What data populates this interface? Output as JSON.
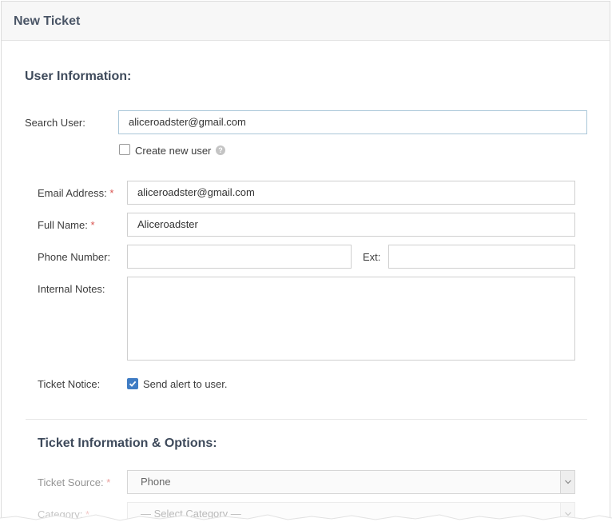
{
  "header": {
    "title": "New Ticket"
  },
  "user_info": {
    "section_title": "User Information:",
    "search_label": "Search User:",
    "search_value": "aliceroadster@gmail.com",
    "create_new_label": "Create new user",
    "create_new_checked": false,
    "email_label": "Email Address:",
    "email_value": "aliceroadster@gmail.com",
    "fullname_label": "Full Name:",
    "fullname_value": "Aliceroadster",
    "phone_label": "Phone Number:",
    "phone_value": "",
    "ext_label": "Ext:",
    "ext_value": "",
    "notes_label": "Internal Notes:",
    "notes_value": "",
    "notice_label": "Ticket Notice:",
    "notice_option": "Send alert to user.",
    "notice_checked": true,
    "required_marker": "*"
  },
  "ticket_info": {
    "section_title": "Ticket Information & Options:",
    "source_label": "Ticket Source:",
    "source_value": "Phone",
    "category_label": "Category:",
    "category_value": "— Select Category —"
  },
  "icons": {
    "help": "question-circle-icon",
    "check": "checkmark-icon",
    "dropdown": "chevron-down-icon"
  }
}
